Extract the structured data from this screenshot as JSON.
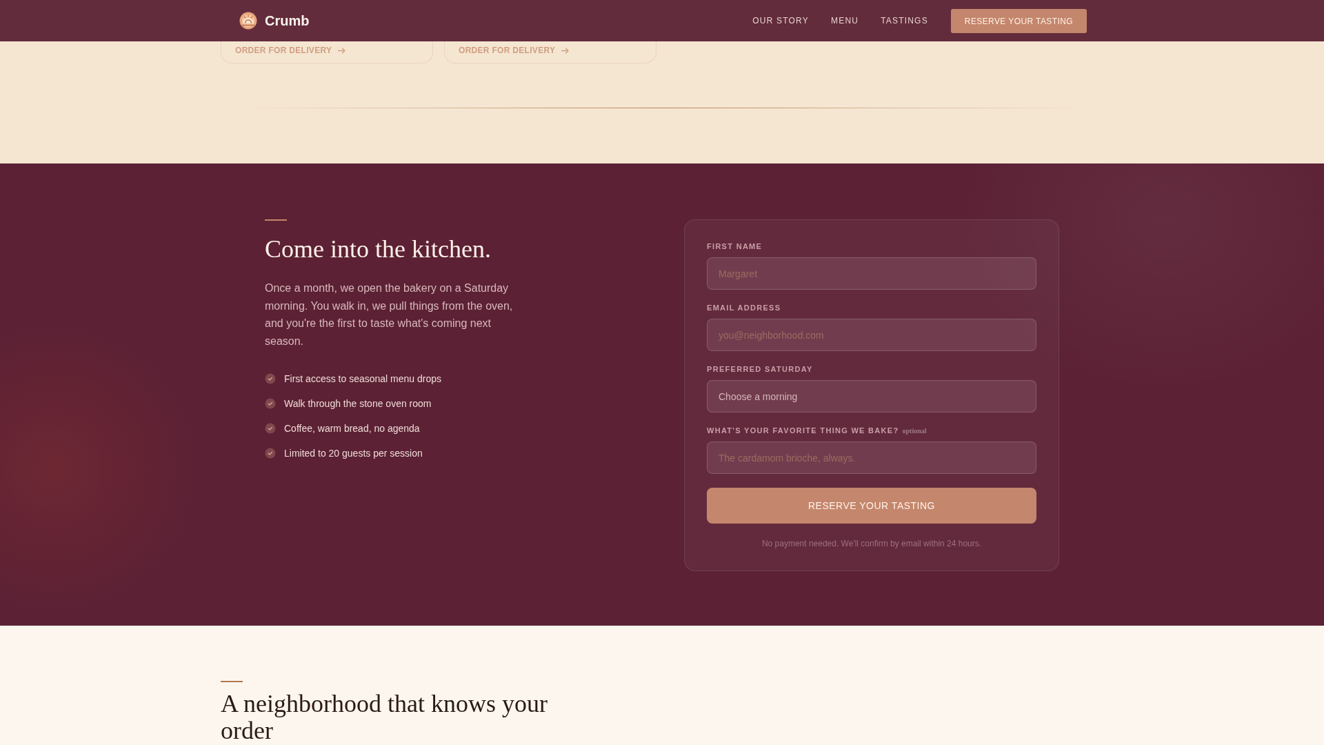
{
  "header": {
    "brand": "Crumb",
    "nav": [
      {
        "label": "OUR STORY"
      },
      {
        "label": "MENU"
      },
      {
        "label": "TASTINGS"
      }
    ],
    "cta": "RESERVE YOUR TASTING"
  },
  "product_cards": [
    {
      "link": "ORDER FOR DELIVERY"
    },
    {
      "link": "ORDER FOR DELIVERY"
    }
  ],
  "tasting": {
    "heading": "Come into the kitchen.",
    "body": "Once a month, we open the bakery on a Saturday morning. You walk in, we pull things from the oven, and you're the first to taste what's coming next season.",
    "perks": [
      "First access to seasonal menu drops",
      "Walk through the stone oven room",
      "Coffee, warm bread, no agenda",
      "Limited to 20 guests per session"
    ]
  },
  "form": {
    "fields": [
      {
        "kind": "input",
        "label": "FIRST NAME",
        "placeholder": "Margaret"
      },
      {
        "kind": "input",
        "label": "EMAIL ADDRESS",
        "placeholder": "you@neighborhood.com"
      },
      {
        "kind": "select",
        "label": "PREFERRED SATURDAY",
        "placeholder": "Choose a morning"
      },
      {
        "kind": "input",
        "label": "WHAT'S YOUR FAVORITE THING WE BAKE?",
        "note": "optional",
        "placeholder": "The cardamom brioche, always."
      }
    ],
    "submit": "RESERVE YOUR TASTING",
    "footnote": "No payment needed. We'll confirm by email within 24 hours."
  },
  "neighborhood": {
    "heading": "A neighborhood that knows your order"
  }
}
